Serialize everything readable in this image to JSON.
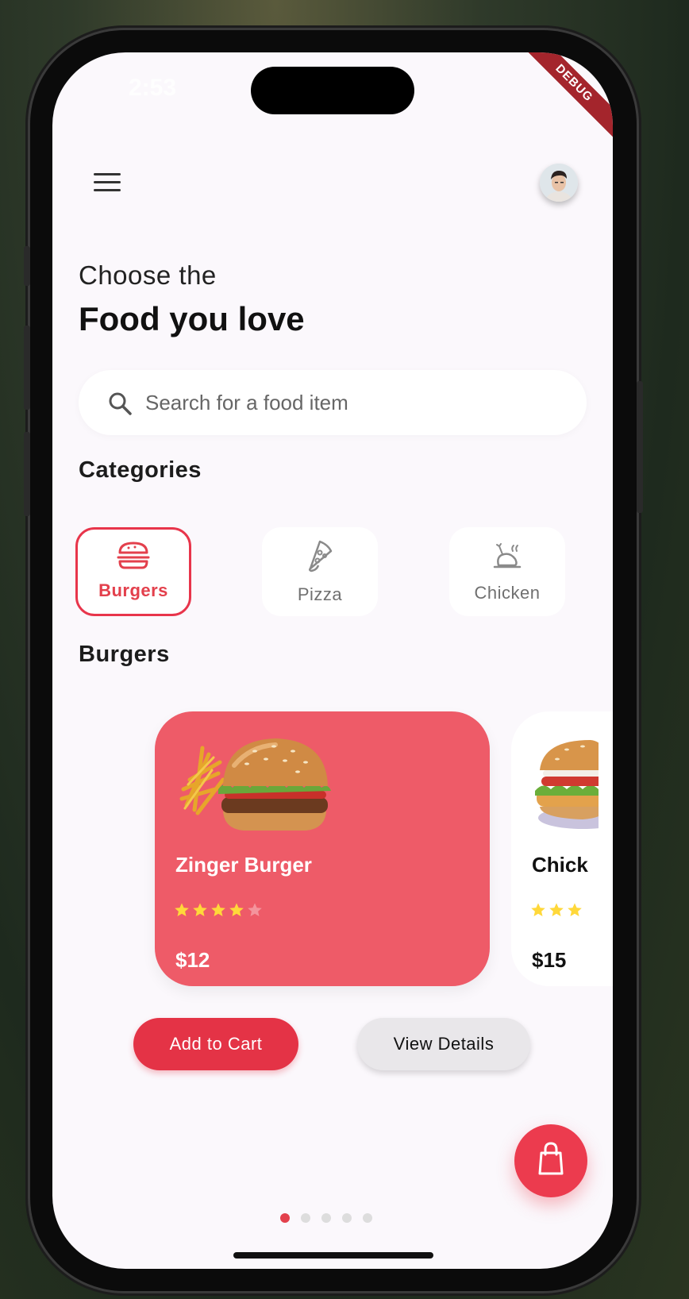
{
  "status": {
    "time": "2:53"
  },
  "debug_banner": "DEBUG",
  "header": {
    "subtitle": "Choose the",
    "title": "Food you love"
  },
  "search": {
    "placeholder": "Search for a food item",
    "value": ""
  },
  "categories": {
    "heading": "Categories",
    "items": [
      {
        "label": "Burgers",
        "icon": "burger-icon",
        "selected": true
      },
      {
        "label": "Pizza",
        "icon": "pizza-icon",
        "selected": false
      },
      {
        "label": "Chicken",
        "icon": "chicken-icon",
        "selected": false
      }
    ]
  },
  "section": {
    "heading": "Burgers"
  },
  "products": [
    {
      "name": "Zinger Burger",
      "rating": 4,
      "max_rating": 5,
      "price": "$12",
      "color": "#ee5b68"
    },
    {
      "name": "Chick",
      "rating": 3,
      "max_rating": 5,
      "price": "$15",
      "color": "#ffffff"
    }
  ],
  "actions": {
    "add_to_cart": "Add to Cart",
    "view_details": "View Details"
  },
  "pagination": {
    "count": 5,
    "active": 0
  },
  "colors": {
    "accent": "#e43346",
    "card": "#ee5b68",
    "star": "#ffd83a",
    "background": "#fbf8fc"
  }
}
